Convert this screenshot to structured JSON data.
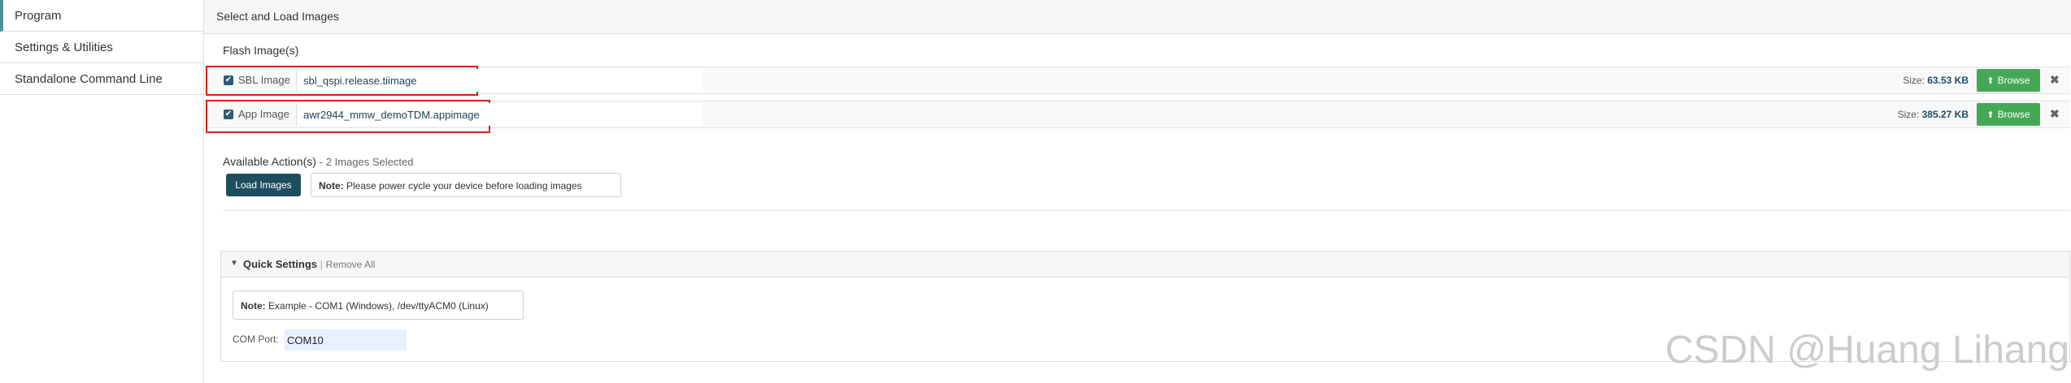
{
  "sidebar": {
    "items": [
      {
        "label": "Program"
      },
      {
        "label": "Settings & Utilities"
      },
      {
        "label": "Standalone Command Line"
      }
    ]
  },
  "header": {
    "title": "Select and Load Images"
  },
  "flash": {
    "title": "Flash Image(s)",
    "rows": [
      {
        "checked": true,
        "label": "SBL Image",
        "path": "sbl_qspi.release.tiimage",
        "size_label": "Size:",
        "size_value": "63.53 KB",
        "browse_label": "Browse"
      },
      {
        "checked": true,
        "label": "App Image",
        "path": "awr2944_mmw_demoTDM.appimage",
        "size_label": "Size:",
        "size_value": "385.27 KB",
        "browse_label": "Browse"
      }
    ]
  },
  "actions": {
    "title": "Available Action(s)",
    "count_text": "- 2 Images Selected",
    "load_label": "Load Images",
    "note_label": "Note:",
    "note_text": "Please power cycle your device before loading images"
  },
  "quick_settings": {
    "title": "Quick Settings",
    "separator": "|",
    "remove_all": "Remove All",
    "note_label": "Note:",
    "note_text": "Example - COM1 (Windows), /dev/ttyACM0 (Linux)",
    "com_label": "COM Port:",
    "com_value": "COM10"
  },
  "watermark": "CSDN @Huang Lihang",
  "colors": {
    "accent": "#4a8ea0",
    "browse_green": "#44a856",
    "load_button": "#1d4e5f",
    "highlight_red": "#d9201d",
    "input_bg": "#e8f0fe"
  },
  "icons": {
    "checkbox": "check-icon",
    "browse": "upload-icon",
    "remove": "close-icon",
    "collapse": "caret-down-icon"
  }
}
